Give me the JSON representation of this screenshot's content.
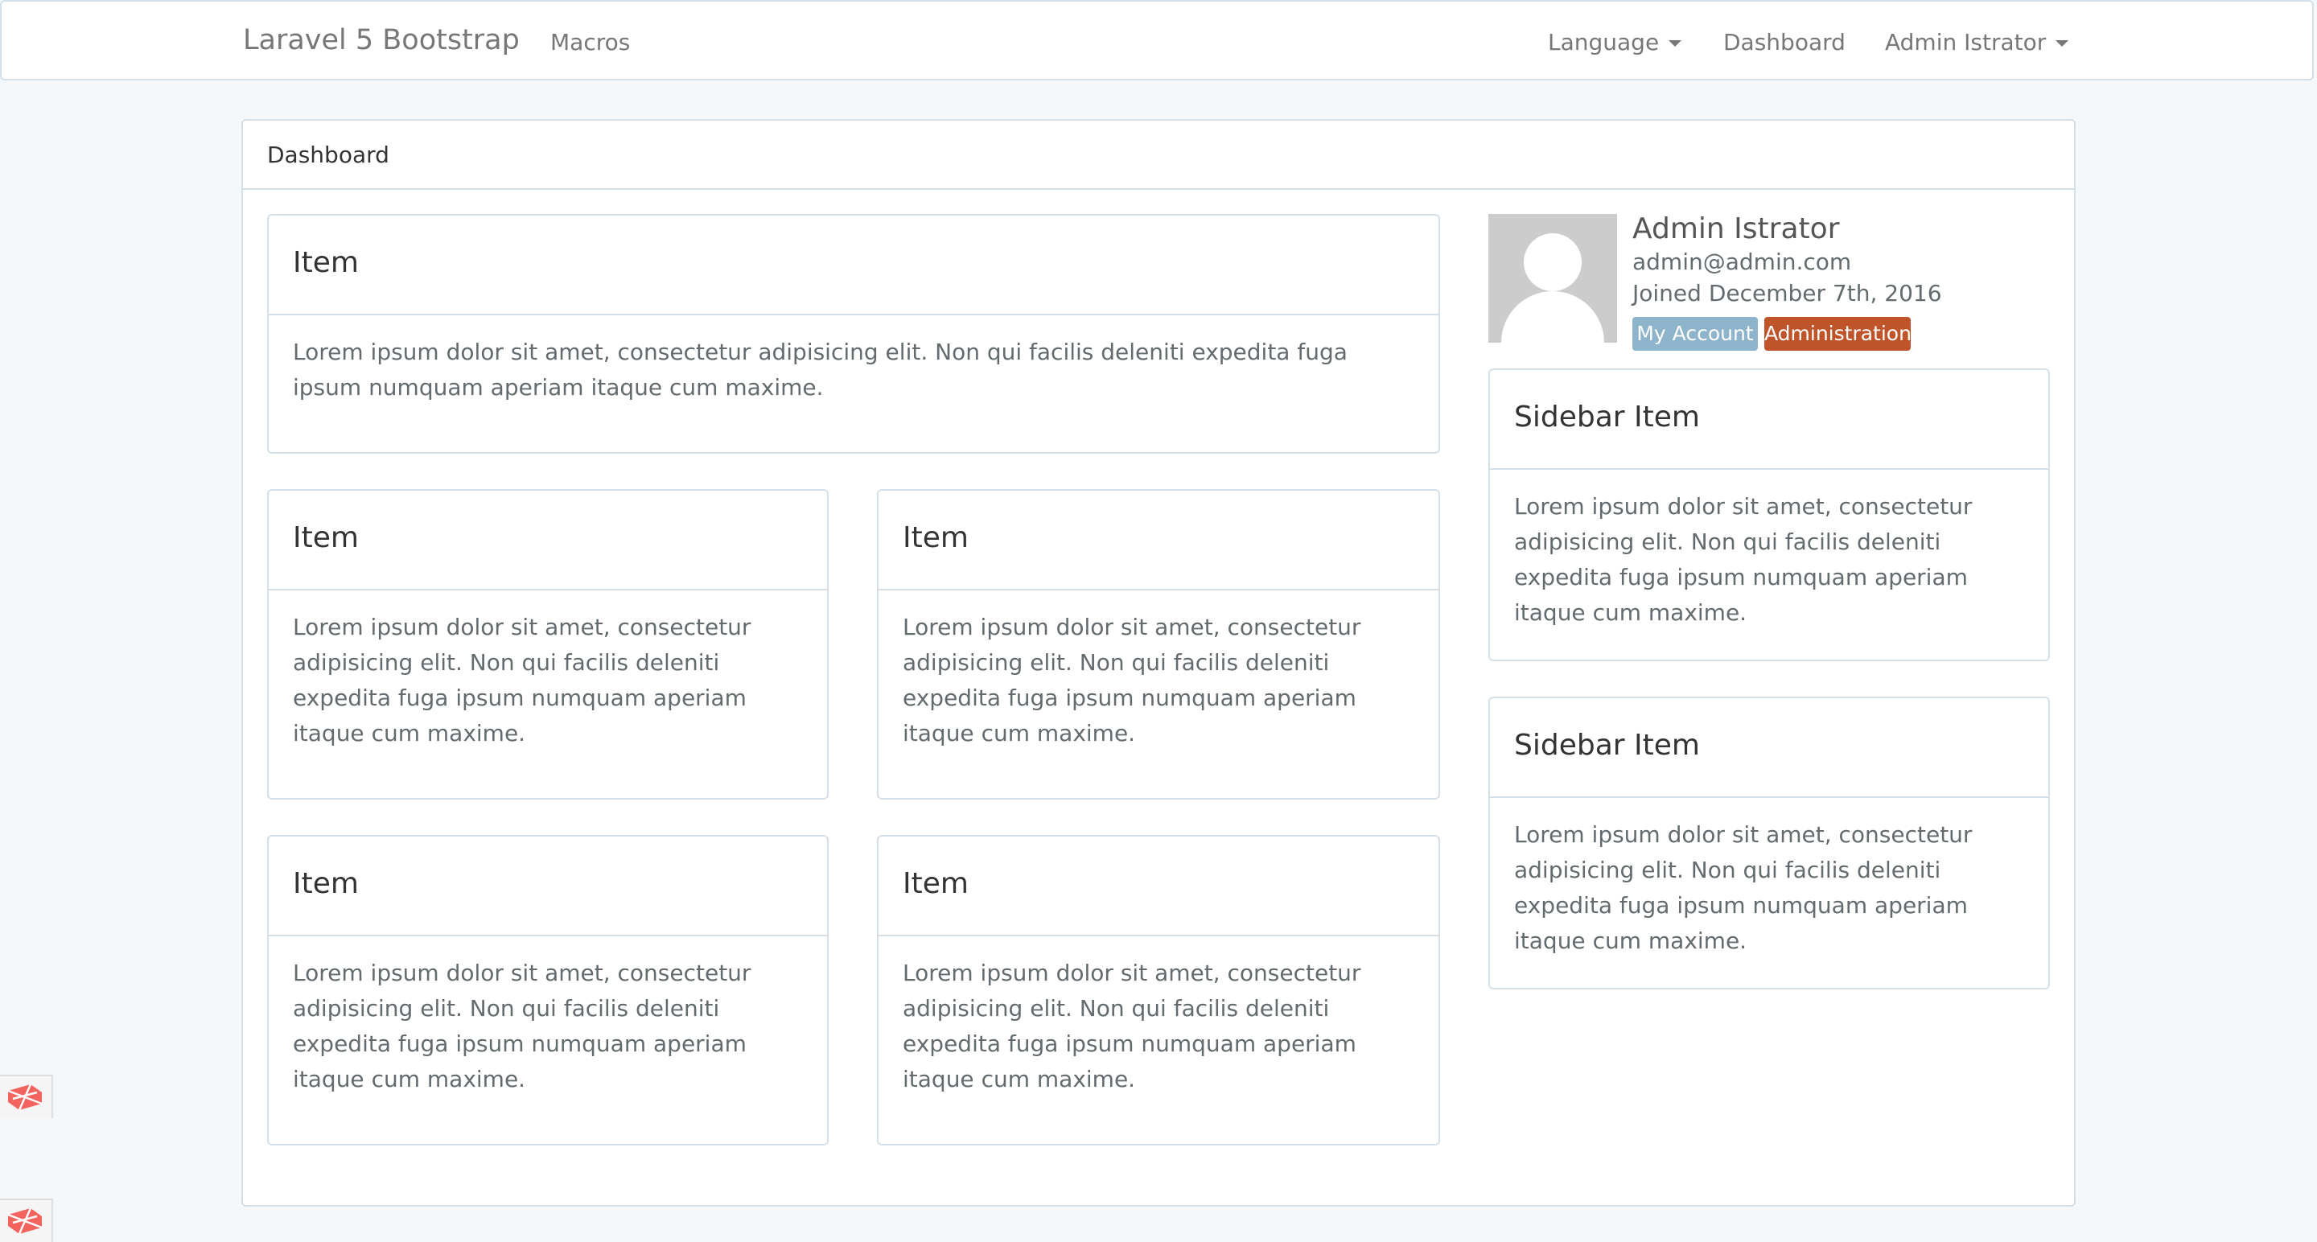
{
  "navbar": {
    "brand": "Laravel 5 Bootstrap",
    "macros": "Macros",
    "language": "Language",
    "dashboard": "Dashboard",
    "user": "Admin Istrator"
  },
  "panel": {
    "title": "Dashboard"
  },
  "items": [
    {
      "title": "Item",
      "body": "Lorem ipsum dolor sit amet, consectetur adipisicing elit. Non qui facilis deleniti expedita fuga ipsum numquam aperiam itaque cum maxime."
    },
    {
      "title": "Item",
      "body": "Lorem ipsum dolor sit amet, consectetur adipisicing elit. Non qui facilis deleniti expedita fuga ipsum numquam aperiam itaque cum maxime."
    },
    {
      "title": "Item",
      "body": "Lorem ipsum dolor sit amet, consectetur adipisicing elit. Non qui facilis deleniti expedita fuga ipsum numquam aperiam itaque cum maxime."
    },
    {
      "title": "Item",
      "body": "Lorem ipsum dolor sit amet, consectetur adipisicing elit. Non qui facilis deleniti expedita fuga ipsum numquam aperiam itaque cum maxime."
    },
    {
      "title": "Item",
      "body": "Lorem ipsum dolor sit amet, consectetur adipisicing elit. Non qui facilis deleniti expedita fuga ipsum numquam aperiam itaque cum maxime."
    }
  ],
  "profile": {
    "name": "Admin Istrator",
    "email": "admin@admin.com",
    "joined": "Joined December 7th, 2016",
    "my_account": "My Account",
    "administration": "Administration",
    "avatar_icon": "user-avatar-icon"
  },
  "sidebar": [
    {
      "title": "Sidebar Item",
      "body": "Lorem ipsum dolor sit amet, consectetur adipisicing elit. Non qui facilis deleniti expedita fuga ipsum numquam aperiam itaque cum maxime."
    },
    {
      "title": "Sidebar Item",
      "body": "Lorem ipsum dolor sit amet, consectetur adipisicing elit. Non qui facilis deleniti expedita fuga ipsum numquam aperiam itaque cum maxime."
    }
  ],
  "colors": {
    "background": "#f5f8fa",
    "border": "#d3e0e9",
    "account_badge": "#8eb4cb",
    "admin_badge": "#bf5329",
    "debugbar_icon": "#f4645f"
  },
  "debugbar": {
    "icon": "laravel-logo-icon"
  }
}
